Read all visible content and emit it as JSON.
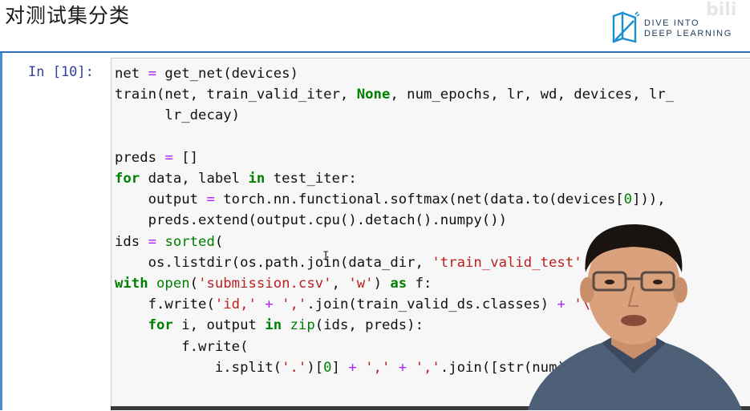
{
  "slide": {
    "title": "对测试集分类"
  },
  "logo": {
    "line1": "DIVE INTO",
    "line2": "DEEP LEARNING",
    "watermark": "bili"
  },
  "cell": {
    "prompt": "In [10]:",
    "lines": [
      [
        [
          "t",
          "net "
        ],
        [
          "op",
          "="
        ],
        [
          "t",
          " get_net(devices)"
        ]
      ],
      [
        [
          "t",
          "train(net, train_valid_iter, "
        ],
        [
          "nn",
          "None"
        ],
        [
          "t",
          ", num_epochs, lr, wd, devices, lr_"
        ]
      ],
      [
        [
          "t",
          "      lr_decay)"
        ]
      ],
      [
        [
          "t",
          ""
        ]
      ],
      [
        [
          "t",
          "preds "
        ],
        [
          "op",
          "="
        ],
        [
          "t",
          " []"
        ]
      ],
      [
        [
          "kw",
          "for"
        ],
        [
          "t",
          " data, label "
        ],
        [
          "kw",
          "in"
        ],
        [
          "t",
          " test_iter:"
        ]
      ],
      [
        [
          "t",
          "    output "
        ],
        [
          "op",
          "="
        ],
        [
          "t",
          " torch.nn.functional.softmax(net(data.to(devices["
        ],
        [
          "nm",
          "0"
        ],
        [
          "t",
          "])),"
        ]
      ],
      [
        [
          "t",
          "    preds.extend(output.cpu().detach().numpy())"
        ]
      ],
      [
        [
          "t",
          "ids "
        ],
        [
          "op",
          "="
        ],
        [
          "t",
          " "
        ],
        [
          "bi",
          "sorted"
        ],
        [
          "t",
          "("
        ]
      ],
      [
        [
          "t",
          "    os.listdir(os.path.join(data_dir, "
        ],
        [
          "st",
          "'train_valid_test'"
        ],
        [
          "t",
          ", "
        ],
        [
          "st",
          "'test'"
        ],
        [
          "t",
          ","
        ]
      ],
      [
        [
          "kw",
          "with"
        ],
        [
          "t",
          " "
        ],
        [
          "bi",
          "open"
        ],
        [
          "t",
          "("
        ],
        [
          "st",
          "'submission.csv'"
        ],
        [
          "t",
          ", "
        ],
        [
          "st",
          "'w'"
        ],
        [
          "t",
          ") "
        ],
        [
          "kw",
          "as"
        ],
        [
          "t",
          " f:"
        ]
      ],
      [
        [
          "t",
          "    f.write("
        ],
        [
          "st",
          "'id,'"
        ],
        [
          "t",
          " "
        ],
        [
          "op",
          "+"
        ],
        [
          "t",
          " "
        ],
        [
          "st",
          "','"
        ],
        [
          "t",
          ".join(train_valid_ds.classes) "
        ],
        [
          "op",
          "+"
        ],
        [
          "t",
          " "
        ],
        [
          "st",
          "'\\n'"
        ],
        [
          "t",
          ")"
        ]
      ],
      [
        [
          "t",
          "    "
        ],
        [
          "kw",
          "for"
        ],
        [
          "t",
          " i, output "
        ],
        [
          "kw",
          "in"
        ],
        [
          "t",
          " "
        ],
        [
          "bi",
          "zip"
        ],
        [
          "t",
          "(ids, preds):"
        ]
      ],
      [
        [
          "t",
          "        f.write("
        ]
      ],
      [
        [
          "t",
          "            i.split("
        ],
        [
          "st",
          "'.'"
        ],
        [
          "t",
          ")["
        ],
        [
          "nm",
          "0"
        ],
        [
          "t",
          "] "
        ],
        [
          "op",
          "+"
        ],
        [
          "t",
          " "
        ],
        [
          "st",
          "','"
        ],
        [
          "t",
          " "
        ],
        [
          "op",
          "+"
        ],
        [
          "t",
          " "
        ],
        [
          "st",
          "','"
        ],
        [
          "t",
          ".join([str(num)"
        ]
      ],
      [
        [
          "t",
          "                                                              ) "
        ],
        [
          "op",
          "+"
        ]
      ]
    ]
  },
  "colors": {
    "keyword": "#008000",
    "operator": "#aa22ff",
    "string": "#ba2121",
    "prompt": "#303f9f",
    "cell_bg": "#f7f7f7",
    "divider": "#2f6fb3"
  },
  "icons": {
    "logo": "book-logo-icon",
    "text_cursor": "text-cursor-icon"
  }
}
